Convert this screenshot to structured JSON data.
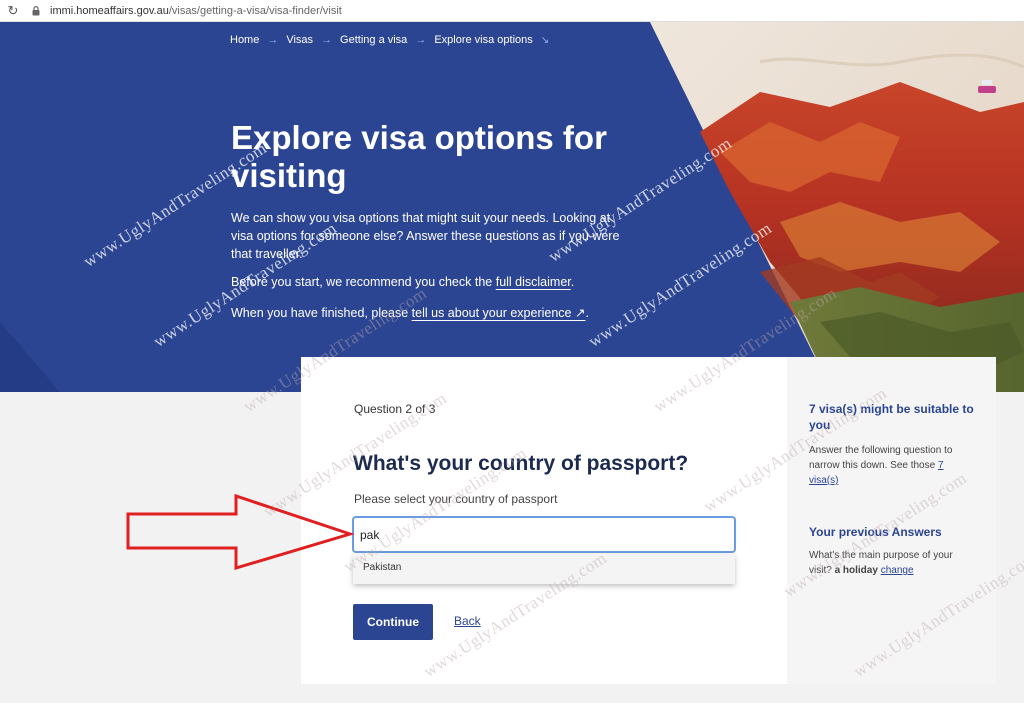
{
  "browser": {
    "url_host": "immi.homeaffairs.gov.au",
    "url_path": "/visas/getting-a-visa/visa-finder/visit"
  },
  "breadcrumb": {
    "items": [
      "Home",
      "Visas",
      "Getting a visa",
      "Explore visa options"
    ]
  },
  "hero": {
    "title": "Explore visa options for visiting",
    "intro": "We can show you visa options that might suit your needs. Looking at visa options for someone else? Answer these questions as if you were that traveller.",
    "disclaimer_prefix": "Before you start, we recommend you check the ",
    "disclaimer_link": "full disclaimer",
    "disclaimer_suffix": ".",
    "feedback_prefix": "When you have finished, please ",
    "feedback_link": "tell us about your experience ↗",
    "feedback_suffix": "."
  },
  "question": {
    "progress": "Question 2 of 3",
    "title": "What's your country of passport?",
    "hint": "Please select your country of passport",
    "input_value": "pak",
    "suggestions": [
      "Pakistan"
    ],
    "continue_label": "Continue",
    "back_label": "Back"
  },
  "sidebar": {
    "result_heading": "7 visa(s) might be suitable to you",
    "result_text": "Answer the following question to narrow this down. See those ",
    "result_link": "7 visa(s)",
    "previous_heading": "Your previous Answers",
    "previous_question": "What's the main purpose of your visit? ",
    "previous_answer": "a holiday",
    "change_label": "change"
  },
  "watermark": {
    "text": "www.UglyAndTraveling.com"
  },
  "colors": {
    "brand_navy": "#2b4592",
    "focus_blue": "#6b9be3",
    "arrow_red": "#e02020"
  }
}
